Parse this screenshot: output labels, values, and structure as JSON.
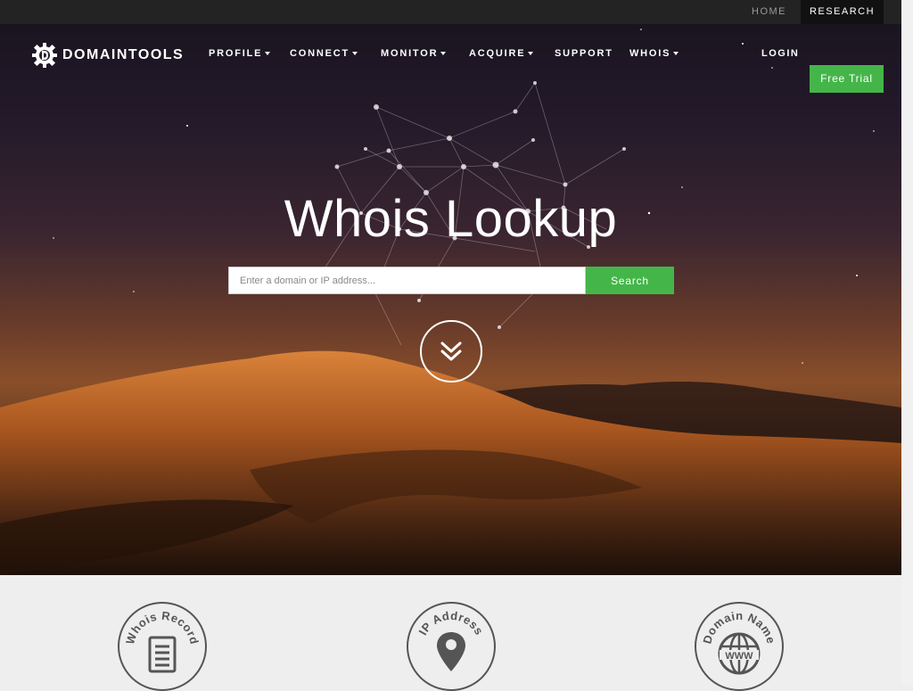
{
  "topbar": {
    "home": "HOME",
    "research": "RESEARCH"
  },
  "brand": {
    "name": "DOMAINTOOLS",
    "icon": "domaintools-gear-logo-icon"
  },
  "nav": {
    "items": [
      {
        "label": "PROFILE",
        "dropdown": true
      },
      {
        "label": "CONNECT",
        "dropdown": true
      },
      {
        "label": "MONITOR",
        "dropdown": true
      },
      {
        "label": "ACQUIRE",
        "dropdown": true
      },
      {
        "label": "SUPPORT",
        "dropdown": false
      },
      {
        "label": "WHOIS",
        "dropdown": true
      }
    ],
    "login": "LOGIN",
    "free_trial": "Free Trial"
  },
  "hero": {
    "title": "Whois Lookup",
    "search_placeholder": "Enter a domain or IP address...",
    "search_button": "Search",
    "scroll_icon": "double-chevron-down-icon"
  },
  "features": [
    {
      "label": "Whois Record",
      "icon": "document-icon"
    },
    {
      "label": "IP Address",
      "icon": "map-pin-icon"
    },
    {
      "label": "Domain Name",
      "icon": "globe-www-icon"
    }
  ],
  "colors": {
    "accent_green": "#44b649",
    "topbar": "#232323",
    "active_tab": "#111111",
    "feature_bg": "#eeeeee",
    "badge_stroke": "#555555"
  }
}
